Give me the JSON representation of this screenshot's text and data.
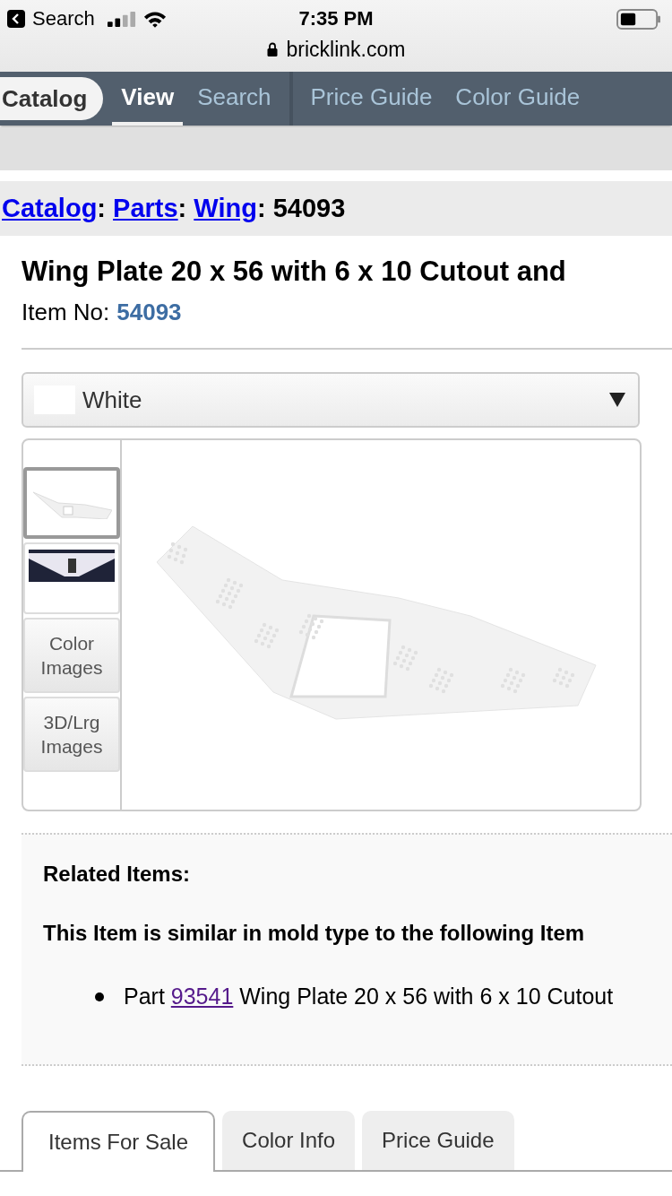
{
  "status_bar": {
    "back_label": "Search",
    "time": "7:35 PM"
  },
  "address_bar": {
    "url": "bricklink.com"
  },
  "nav": [
    {
      "items": [
        {
          "label": "Catalog",
          "kind": "home",
          "selected": false
        },
        {
          "label": "View",
          "kind": "tab",
          "selected": true
        },
        {
          "label": "Search",
          "kind": "tab",
          "selected": false
        }
      ]
    },
    {
      "items": [
        {
          "label": "Price Guide",
          "kind": "tab",
          "selected": false
        },
        {
          "label": "Color Guide",
          "kind": "tab",
          "selected": false
        }
      ]
    }
  ],
  "breadcrumb": {
    "separator": ":",
    "links": [
      "Catalog",
      "Parts",
      "Wing"
    ],
    "current": "54093"
  },
  "item": {
    "title": "Wing Plate 20 x 56 with 6 x 10 Cutout and",
    "number_label": "Item No:",
    "number": "54093"
  },
  "color_select": {
    "value": "White"
  },
  "thumbnails": [
    {
      "kind": "render",
      "selected": true
    },
    {
      "kind": "photo",
      "selected": false
    },
    {
      "kind": "button",
      "label": "Color Images"
    },
    {
      "kind": "button",
      "label": "3D/Lrg Images"
    }
  ],
  "related": {
    "title": "Related Items:",
    "intro": "This Item is similar in mold type to the following Item",
    "items": [
      {
        "prefix": "Part",
        "link": "93541",
        "text": "Wing Plate 20 x 56 with 6 x 10 Cutout"
      }
    ]
  },
  "bottom_tabs": [
    {
      "label": "Items For Sale",
      "selected": true
    },
    {
      "label": "Color Info",
      "selected": false
    },
    {
      "label": "Price Guide",
      "selected": false
    }
  ]
}
